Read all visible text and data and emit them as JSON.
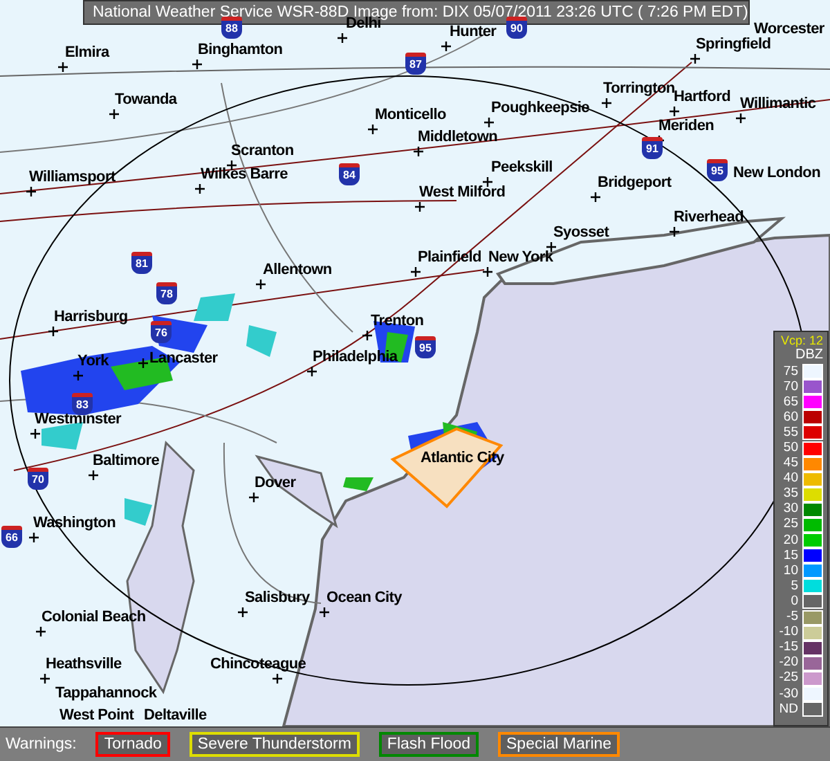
{
  "title": "National Weather Service WSR-88D Image from: DIX 05/07/2011 23:26 UTC ( 7:26 PM EDT)",
  "cities": [
    {
      "name": "Delhi"
    },
    {
      "name": "Hunter"
    },
    {
      "name": "Worcester"
    },
    {
      "name": "Elmira"
    },
    {
      "name": "Binghamton"
    },
    {
      "name": "Springfield"
    },
    {
      "name": "Towanda"
    },
    {
      "name": "Torrington"
    },
    {
      "name": "Hartford"
    },
    {
      "name": "Willimantic"
    },
    {
      "name": "Monticello"
    },
    {
      "name": "Poughkeepsie"
    },
    {
      "name": "Middletown"
    },
    {
      "name": "Meriden"
    },
    {
      "name": "Scranton"
    },
    {
      "name": "Williamsport"
    },
    {
      "name": "Wilkes Barre"
    },
    {
      "name": "Peekskill"
    },
    {
      "name": "Bridgeport"
    },
    {
      "name": "New London"
    },
    {
      "name": "West Milford"
    },
    {
      "name": "Riverhead"
    },
    {
      "name": "Syosset"
    },
    {
      "name": "Plainfield"
    },
    {
      "name": "New York"
    },
    {
      "name": "Allentown"
    },
    {
      "name": "Harrisburg"
    },
    {
      "name": "Trenton"
    },
    {
      "name": "York"
    },
    {
      "name": "Lancaster"
    },
    {
      "name": "Philadelphia"
    },
    {
      "name": "Westminster"
    },
    {
      "name": "Atlantic City"
    },
    {
      "name": "Baltimore"
    },
    {
      "name": "Dover"
    },
    {
      "name": "Washington"
    },
    {
      "name": "Salisbury"
    },
    {
      "name": "Ocean City"
    },
    {
      "name": "Colonial Beach"
    },
    {
      "name": "Chincoteague"
    },
    {
      "name": "Heathsville"
    },
    {
      "name": "Tappahannock"
    },
    {
      "name": "West Point"
    },
    {
      "name": "Deltaville"
    }
  ],
  "interstates": [
    {
      "label": "88"
    },
    {
      "label": "87"
    },
    {
      "label": "90"
    },
    {
      "label": "84"
    },
    {
      "label": "91"
    },
    {
      "label": "95"
    },
    {
      "label": "81"
    },
    {
      "label": "78"
    },
    {
      "label": "76"
    },
    {
      "label": "83"
    },
    {
      "label": "95"
    },
    {
      "label": "70"
    },
    {
      "label": "66"
    }
  ],
  "legend": {
    "vcp": "Vcp: 12",
    "unit": "DBZ",
    "items": [
      {
        "label": "75",
        "color": "#eef6ff"
      },
      {
        "label": "70",
        "color": "#9955cc"
      },
      {
        "label": "65",
        "color": "#ff00ff"
      },
      {
        "label": "60",
        "color": "#bb0000"
      },
      {
        "label": "55",
        "color": "#dd0000"
      },
      {
        "label": "50",
        "color": "#ff0000"
      },
      {
        "label": "45",
        "color": "#ff8800"
      },
      {
        "label": "40",
        "color": "#eebb00"
      },
      {
        "label": "35",
        "color": "#dddd00"
      },
      {
        "label": "30",
        "color": "#008800"
      },
      {
        "label": "25",
        "color": "#00bb00"
      },
      {
        "label": "20",
        "color": "#00cc00"
      },
      {
        "label": "15",
        "color": "#0000ff"
      },
      {
        "label": "10",
        "color": "#0099ff"
      },
      {
        "label": "5",
        "color": "#00dddd"
      },
      {
        "label": "0",
        "color": "#666666"
      },
      {
        "label": "-5",
        "color": "#999966"
      },
      {
        "label": "-10",
        "color": "#cccc99"
      },
      {
        "label": "-15",
        "color": "#663366"
      },
      {
        "label": "-20",
        "color": "#996699"
      },
      {
        "label": "-25",
        "color": "#cc99cc"
      },
      {
        "label": "-30",
        "color": "#eef6ff"
      },
      {
        "label": "ND",
        "color": "#666666"
      }
    ]
  },
  "warnings": {
    "label": "Warnings:",
    "items": [
      {
        "label": "Tornado",
        "color": "#ff0000"
      },
      {
        "label": "Severe Thunderstorm",
        "color": "#dddd00"
      },
      {
        "label": "Flash Flood",
        "color": "#008800"
      },
      {
        "label": "Special Marine",
        "color": "#ff8800"
      }
    ]
  }
}
